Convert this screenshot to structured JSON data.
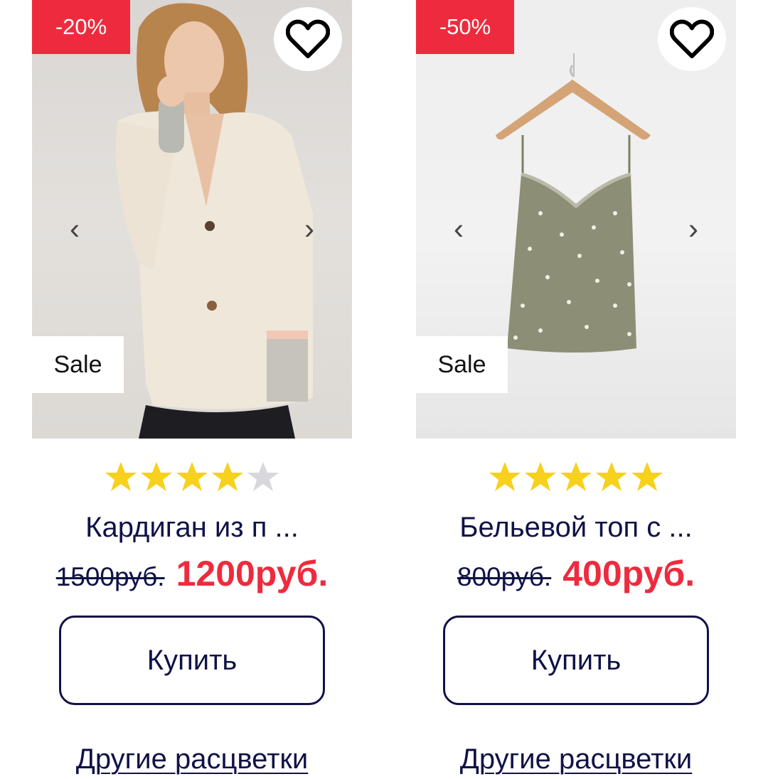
{
  "products": [
    {
      "discount_badge": "-20%",
      "sale_label": "Sale",
      "rating": 4,
      "rating_max": 5,
      "title": "Кардиган из п ...",
      "old_price": "1500руб.",
      "new_price": "1200руб.",
      "buy_label": "Купить",
      "other_colors_label": "Другие расцветки",
      "icons": {
        "favorite": "heart-icon",
        "prev": "chevron-left-icon",
        "next": "chevron-right-icon",
        "star": "star-icon"
      },
      "image": "woman-in-beige-cardigan"
    },
    {
      "discount_badge": "-50%",
      "sale_label": "Sale",
      "rating": 5,
      "rating_max": 5,
      "title": "Бельевой топ с ...",
      "old_price": "800руб.",
      "new_price": "400руб.",
      "buy_label": "Купить",
      "other_colors_label": "Другие расцветки",
      "icons": {
        "favorite": "heart-icon",
        "prev": "chevron-left-icon",
        "next": "chevron-right-icon",
        "star": "star-icon"
      },
      "image": "olive-polka-dot-camisole-on-hanger"
    }
  ],
  "colors": {
    "accent_red": "#ee2b3e",
    "text_navy": "#101247",
    "star_filled": "#f7d11c",
    "star_empty": "#d8d8dc"
  }
}
